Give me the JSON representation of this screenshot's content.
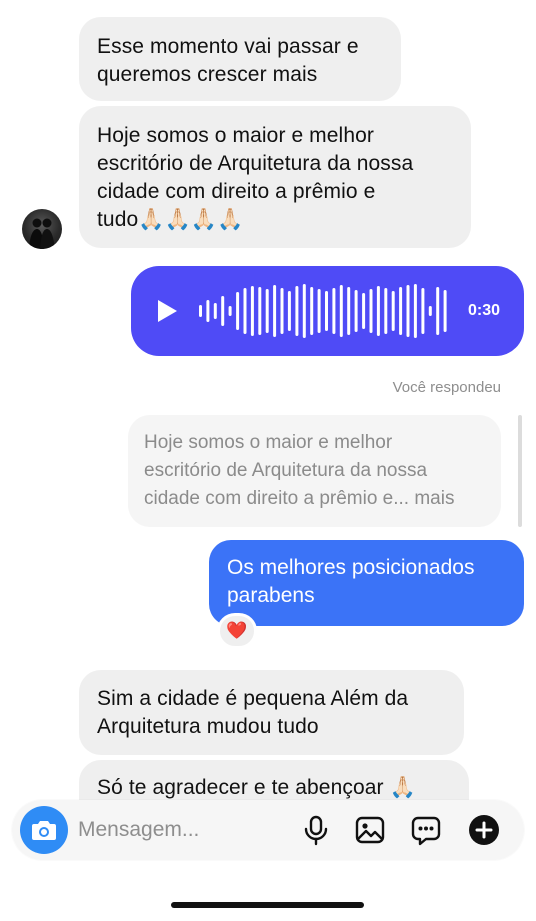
{
  "messages": {
    "incoming_1": "Esse momento vai passar e\nqueremos crescer mais",
    "incoming_2": "Hoje somos o maior e melhor\nescritório de Arquitetura da nossa\ncidade com direito a prêmio e\ntudo🙏🏻🙏🏻🙏🏻🙏🏻",
    "incoming_3": "Sim a cidade é pequena  Além da\nArquitetura mudou tudo",
    "incoming_4": "Só te agradecer e te abençoar 🙏🏻"
  },
  "voice_message": {
    "duration": "0:30",
    "icon": "play-icon"
  },
  "reply": {
    "label": "Você respondeu",
    "quoted_text": "Hoje somos o maior e melhor\nescritório de Arquitetura da nossa\ncidade com direito a prêmio e... mais",
    "outgoing_text": "Os melhores posicionados\nparabens",
    "reaction": "❤️"
  },
  "composer": {
    "placeholder": "Mensagem...",
    "icons": [
      "camera-icon",
      "microphone-icon",
      "gallery-icon",
      "sticker-icon",
      "plus-icon"
    ]
  },
  "colors": {
    "incoming_bubble": "#efefef",
    "voice_bubble": "#4f4bf6",
    "outgoing_bubble": "#3b73f7",
    "camera_button": "#2f8cf5"
  }
}
